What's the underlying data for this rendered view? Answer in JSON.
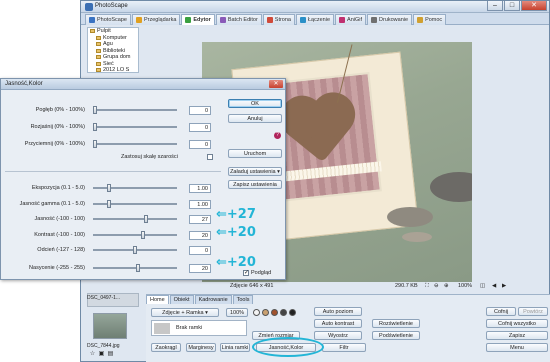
{
  "window": {
    "title": "PhotoScape",
    "controls": [
      "–",
      "□",
      "✕"
    ]
  },
  "app_tabs": [
    {
      "label": "PhotoScape",
      "color": "#3a73c2",
      "active": false
    },
    {
      "label": "Przeglądarka",
      "color": "#e0a020",
      "active": false
    },
    {
      "label": "Edytor",
      "color": "#3aa040",
      "active": true
    },
    {
      "label": "Batch Editor",
      "color": "#8a5ab8",
      "active": false
    },
    {
      "label": "Strona",
      "color": "#d04a3a",
      "active": false
    },
    {
      "label": "Łączenie",
      "color": "#2a90c8",
      "active": false
    },
    {
      "label": "AniGif",
      "color": "#c03070",
      "active": false
    },
    {
      "label": "Drukowanie",
      "color": "#707070",
      "active": false
    },
    {
      "label": "Pomoc",
      "color": "#d0a030",
      "active": false
    }
  ],
  "tree": [
    "Pulpit",
    "Komputer",
    "Agu",
    "Biblioteki",
    "Grupa dom",
    "Sieć",
    "2012 LO S"
  ],
  "status": {
    "dims": "Zdjęcie 646 x 491",
    "size": "290.7 KB",
    "zoom": "100%"
  },
  "thumbs": {
    "top_label": "DSC_0497-1...",
    "bottom_label": "DSC_7844.jpg"
  },
  "bottom": {
    "tabs": [
      "Home",
      "Obiekt",
      "Kadrowanie",
      "Tools"
    ],
    "frame_select": "Zdjęcie + Ramka",
    "frame_value": "100%",
    "frame_name": "Brak ramki",
    "buttons": {
      "zaokragl": "Zaokrągl",
      "marginesy": "Marginesy",
      "linia": "Linia ramki",
      "jasnosc": "Jasność,Kolor",
      "filtr": "Filtr",
      "zmien": "Zmień rozmiar",
      "auto_poziom": "Auto poziom",
      "auto_kontrast": "Auto kontrast",
      "wyostrz": "Wyostrz",
      "rozswietlenie": "Rozświetlenie",
      "podswietlenie": "Podświetlenie",
      "cofnij": "Cofnij",
      "powtorz": "Powtórz",
      "cofnij_wszystko": "Cofnij wszystko",
      "zapisz": "Zapisz",
      "menu": "Menu"
    }
  },
  "dialog": {
    "title": "Jasność,Kolor",
    "rows_top": [
      {
        "label": "Pogłęb (0% - 100%)",
        "value": "0",
        "pos": 0
      },
      {
        "label": "Rozjaśnij (0% - 100%)",
        "value": "0",
        "pos": 0
      },
      {
        "label": "Przyciemnij (0% - 100%)",
        "value": "0",
        "pos": 0
      }
    ],
    "grayscale_label": "Zastosuj skalę szarości",
    "rows_bottom": [
      {
        "label": "Ekspozycja (0.1 - 5.0)",
        "value": "1.00",
        "pos": 0.18
      },
      {
        "label": "Jasność gamma (0.1 - 5.0)",
        "value": "1.00",
        "pos": 0.18
      },
      {
        "label": "Jasność (-100 - 100)",
        "value": "27",
        "pos": 0.635
      },
      {
        "label": "Kontrast (-100 - 100)",
        "value": "20",
        "pos": 0.6
      },
      {
        "label": "Odcień (-127 - 128)",
        "value": "0",
        "pos": 0.5
      },
      {
        "label": "Nasycenie (-255 - 255)",
        "value": "20",
        "pos": 0.54
      }
    ],
    "buttons": {
      "ok": "OK",
      "cancel": "Anuluj",
      "run": "Uruchom",
      "load": "Załaduj ustawienia",
      "save": "Zapisz ustawienia"
    },
    "preview_label": "Podgląd",
    "help": "?"
  },
  "annotations": [
    "+27",
    "+20",
    "+20"
  ]
}
